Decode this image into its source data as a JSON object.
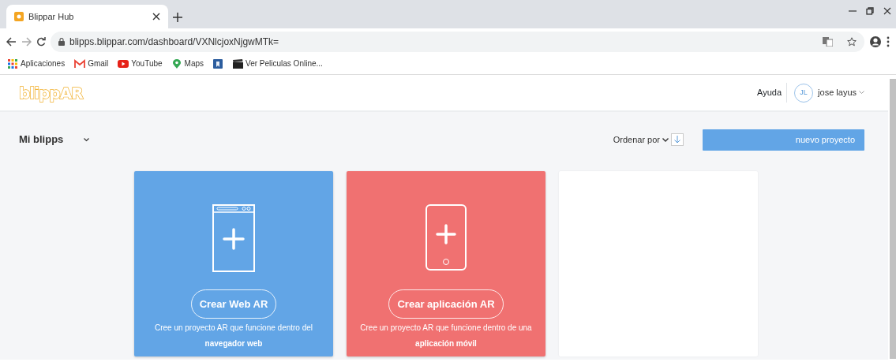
{
  "browser": {
    "tabs": [
      {
        "title": "Blippar Hub",
        "selected": true
      }
    ],
    "address": "blipps.blippar.com/dashboard/VXNlcjoxNjgwMTk=",
    "bookmarks": [
      {
        "kind": "apps",
        "label": "Aplicaciones"
      },
      {
        "kind": "gmail",
        "label": "Gmail"
      },
      {
        "kind": "youtube",
        "label": "YouTube"
      },
      {
        "kind": "maps",
        "label": "Maps"
      },
      {
        "kind": "square"
      },
      {
        "kind": "film",
        "label": "Ver Peliculas Online..."
      }
    ]
  },
  "header": {
    "logo": "blippAR",
    "help": "Ayuda",
    "user": {
      "initials": "JL",
      "name": "jose layus"
    }
  },
  "toolbar": {
    "title": "Mi blipps",
    "sort": "Ordenar por",
    "new_button": "nuevo proyecto"
  },
  "cards": [
    {
      "kind": "browser",
      "color": "#62a5e6",
      "button": "Crear Web AR",
      "description": "Cree un proyecto AR que funcione dentro del **navegador web**"
    },
    {
      "kind": "phone",
      "color": "#f07171",
      "button": "Crear aplicación AR",
      "description": "Cree un proyecto AR que funcione dentro de una **aplicación móvil**"
    },
    {
      "kind": "empty"
    }
  ]
}
